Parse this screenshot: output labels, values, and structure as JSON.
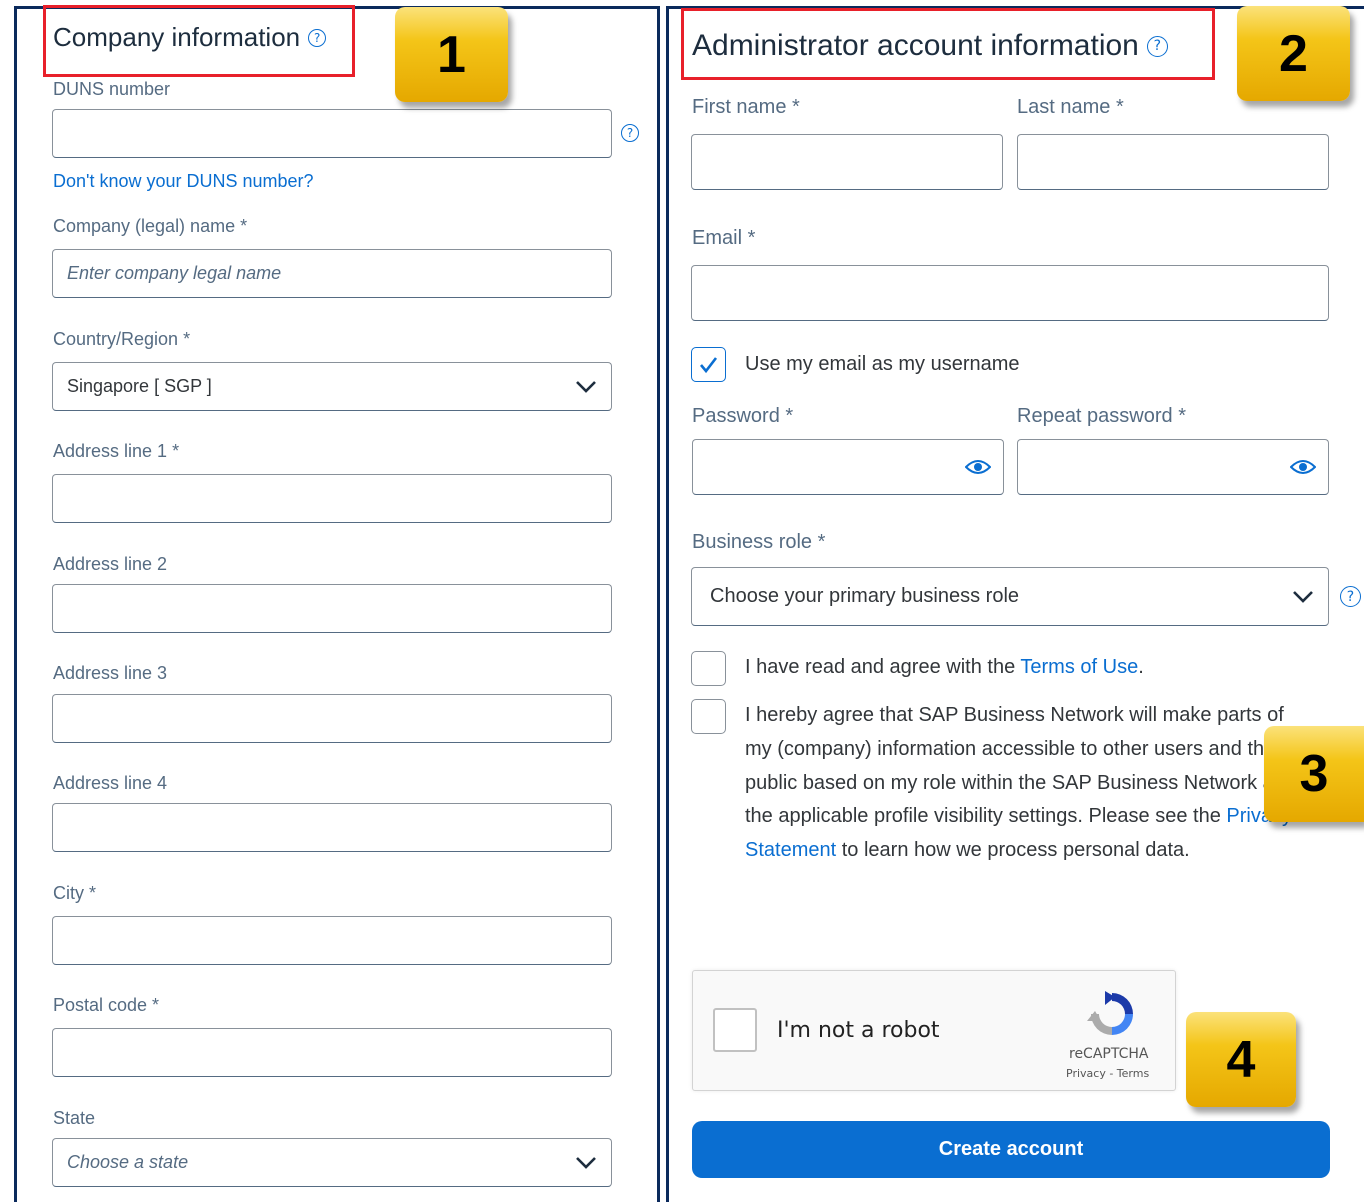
{
  "company": {
    "title": "Company information",
    "help_glyph": "?",
    "duns_label": "DUNS number",
    "duns_value": "",
    "duns_link": "Don't know your DUNS number?",
    "legal_name_label": "Company (legal) name  *",
    "legal_name_placeholder": "Enter company legal name",
    "country_label": "Country/Region  *",
    "country_value": "Singapore [ SGP ]",
    "address1_label": "Address line 1  *",
    "address2_label": "Address line 2",
    "address3_label": "Address line 3",
    "address4_label": "Address line 4",
    "city_label": "City  *",
    "postal_label": "Postal code  *",
    "state_label": "State",
    "state_placeholder": "Choose a state"
  },
  "admin": {
    "title": "Administrator account information",
    "help_glyph": "?",
    "first_name_label": "First name  *",
    "last_name_label": "Last name  *",
    "email_label": "Email  *",
    "use_email_label": "Use my email as my username",
    "use_email_checked": true,
    "password_label": "Password  *",
    "repeat_password_label": "Repeat password  *",
    "business_role_label": "Business role *",
    "business_role_value": "Choose your primary business role",
    "terms_prefix": "I have read and agree with the ",
    "terms_link": "Terms of Use",
    "terms_suffix": ".",
    "consent_text_1": "I hereby agree that SAP Business Network will make parts of my (company) information accessible to other users and the public based on my role within the SAP Business Network and the applicable profile visibility settings. Please see the ",
    "privacy_link": "Privacy Statement",
    "consent_text_2": " to learn how we process personal data."
  },
  "captcha": {
    "label": "I'm not a robot",
    "brand": "reCAPTCHA",
    "legal": "Privacy - Terms"
  },
  "create_button": "Create account",
  "badges": {
    "b1": "1",
    "b2": "2",
    "b3": "3",
    "b4": "4"
  },
  "colors": {
    "accent": "#0a6ed1",
    "panel_border": "#0b2a5c",
    "highlight": "#e8202a",
    "badge": "#f4c518"
  },
  "icons": {
    "help": "help-circle-icon",
    "dropdown": "chevron-down-icon",
    "reveal": "eye-icon",
    "check": "checkmark-icon"
  }
}
